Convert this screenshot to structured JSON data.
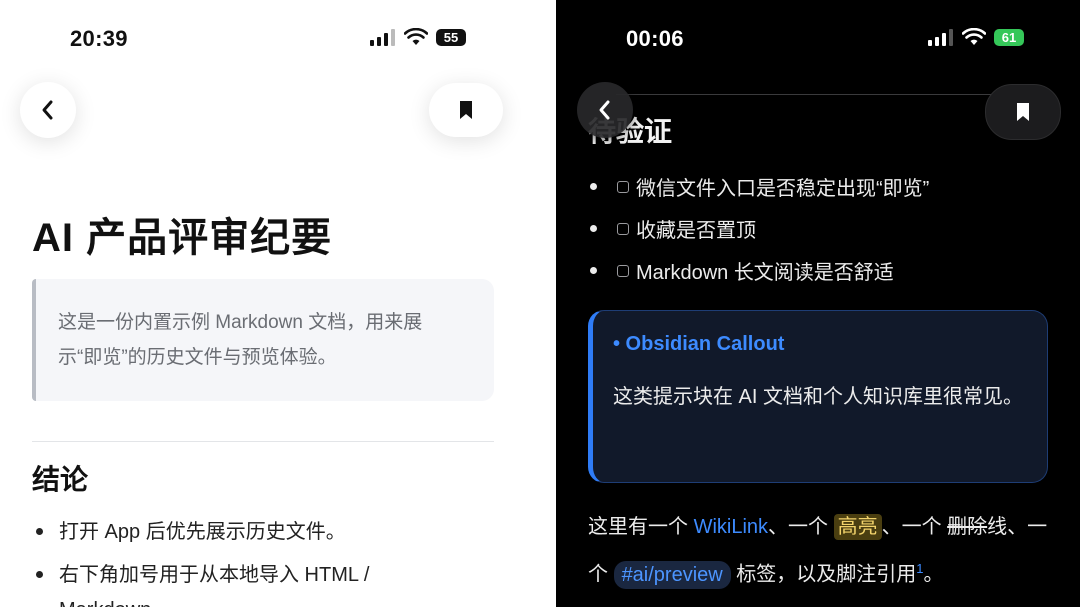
{
  "left": {
    "status": {
      "time": "20:39",
      "battery": "55"
    },
    "doc": {
      "title": "AI 产品评审纪要",
      "quote_line1": "这是一份内置示例 Markdown 文档，用来展",
      "quote_line2": "示“即览”的历史文件与预览体验。",
      "section_heading": "结论",
      "bullets": [
        "打开 App 后优先展示历史文件。",
        "右下角加号用于从本地导入 HTML /"
      ],
      "bullet_overflow": "Markdown"
    }
  },
  "right": {
    "status": {
      "time": "00:06",
      "battery": "61"
    },
    "doc": {
      "heading_partial": "待验证",
      "tasks": [
        "微信文件入口是否稳定出现“即览”",
        "收藏是否置顶",
        "Markdown 长文阅读是否舒适"
      ],
      "callout_title": "• Obsidian Callout",
      "callout_body": "这类提示块在 AI 文档和个人知识库里很常见。",
      "para_prefix": "这里有一个 ",
      "wikilink": "WikiLink",
      "para_sep1": "、一个 ",
      "highlight": "高亮",
      "para_sep2": "、一个 ",
      "strike": "删除",
      "para_sep3": "线、一个 ",
      "tag": "#ai/preview",
      "para_sep4": " 标签，以及脚注引用",
      "footnote": "1",
      "para_end": "。"
    }
  },
  "icons": {
    "back": "chevron-left-icon",
    "bookmark": "bookmark-icon",
    "signal": "cellular-signal-icon",
    "wifi": "wifi-icon"
  },
  "colors": {
    "accent_blue": "#3d8bff",
    "callout_border": "#2f7cf6",
    "highlight_bg": "#4a3e10"
  }
}
